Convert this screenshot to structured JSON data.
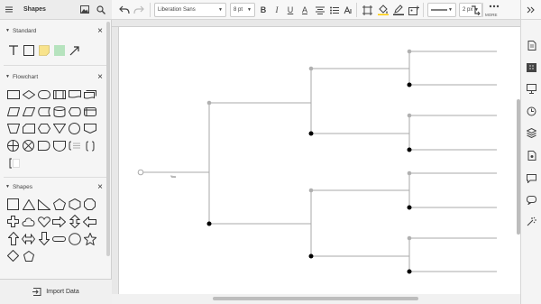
{
  "left_panel": {
    "title": "Shapes",
    "sections": {
      "standard": "Standard",
      "flowchart": "Flowchart",
      "shapes": "Shapes"
    },
    "import_label": "Import Data"
  },
  "toolbar": {
    "font": "Liberation Sans",
    "font_size": "8 pt",
    "bold": "B",
    "italic": "I",
    "underline": "U",
    "text_color": "A",
    "line_width": "2 px",
    "more": "MORE"
  },
  "canvas": {
    "root_label": "You"
  },
  "colors": {
    "accent": "#fc0",
    "line": "#aaaaaa",
    "node_filled": "#000000",
    "node_gray": "#b0b0b0"
  }
}
